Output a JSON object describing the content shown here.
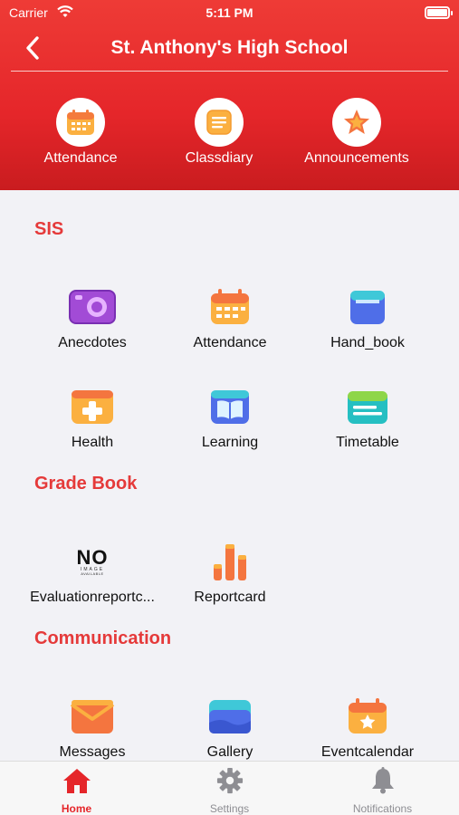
{
  "status": {
    "carrier": "Carrier",
    "time": "5:11 PM"
  },
  "header": {
    "title": "St. Anthony's High School"
  },
  "quick_actions": [
    {
      "label": "Attendance",
      "icon": "calendar-icon"
    },
    {
      "label": "Classdiary",
      "icon": "notes-icon"
    },
    {
      "label": "Announcements",
      "icon": "star-badge-icon"
    }
  ],
  "sections": {
    "sis": {
      "title": "SIS",
      "items": [
        {
          "label": "Anecdotes",
          "icon": "camera-icon"
        },
        {
          "label": "Attendance",
          "icon": "calendar-icon"
        },
        {
          "label": "Hand_book",
          "icon": "book-icon"
        },
        {
          "label": "Health",
          "icon": "first-aid-icon"
        },
        {
          "label": "Learning",
          "icon": "open-book-icon"
        },
        {
          "label": "Timetable",
          "icon": "timetable-icon"
        }
      ]
    },
    "grade_book": {
      "title": "Grade Book",
      "items": [
        {
          "label": "Evaluationreportc...",
          "icon": "no-image-icon",
          "placeholder_big": "NO",
          "placeholder_small": "IMAGE",
          "placeholder_small2": "AVAILABLE"
        },
        {
          "label": "Reportcard",
          "icon": "bar-chart-icon"
        }
      ]
    },
    "communication": {
      "title": "Communication",
      "items": [
        {
          "label": "Messages",
          "icon": "envelope-icon"
        },
        {
          "label": "Gallery",
          "icon": "gallery-icon"
        },
        {
          "label": "Eventcalendar",
          "icon": "event-calendar-icon"
        }
      ]
    }
  },
  "tabbar": [
    {
      "label": "Home",
      "icon": "home-icon",
      "active": true
    },
    {
      "label": "Settings",
      "icon": "gear-icon",
      "active": false
    },
    {
      "label": "Notifications",
      "icon": "bell-icon",
      "active": false
    }
  ],
  "colors": {
    "brand_red": "#e5262a",
    "section_title": "#e53a3a",
    "tab_active": "#e5262a",
    "tab_inactive": "#8e8e93"
  }
}
